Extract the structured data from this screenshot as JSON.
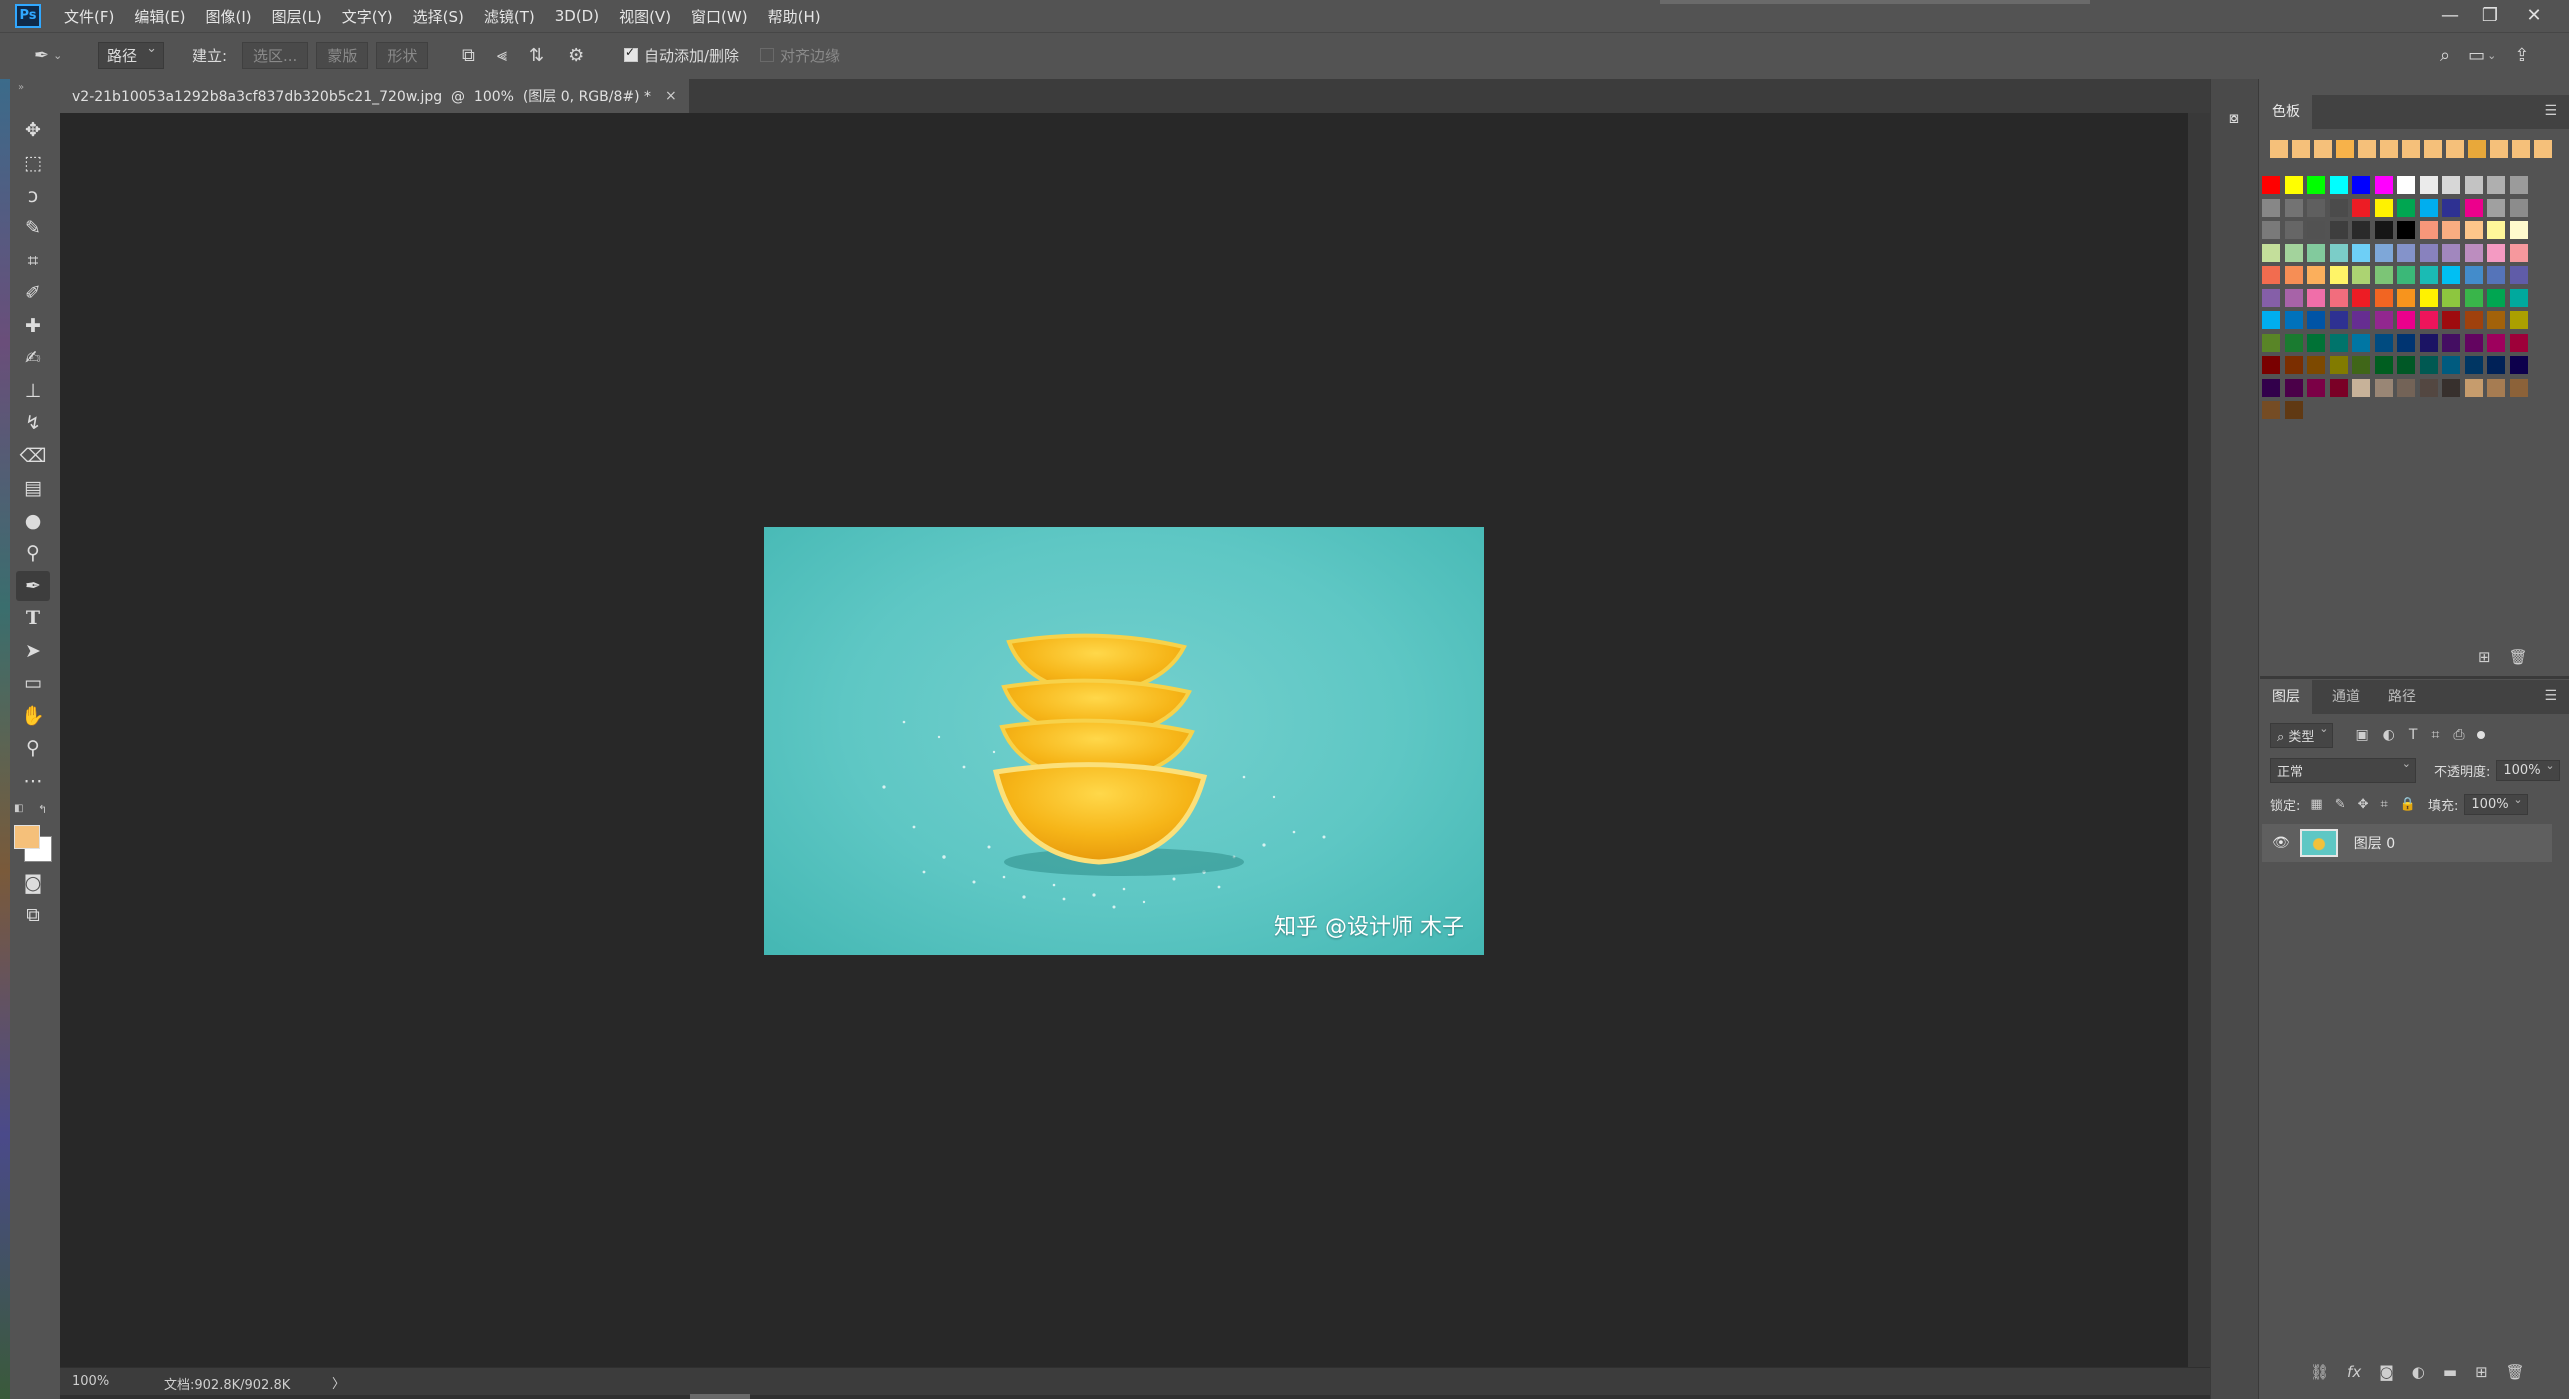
{
  "app": {
    "logo": "Ps",
    "menus": [
      "文件(F)",
      "编辑(E)",
      "图像(I)",
      "图层(L)",
      "文字(Y)",
      "选择(S)",
      "滤镜(T)",
      "3D(D)",
      "视图(V)",
      "窗口(W)",
      "帮助(H)"
    ],
    "window_controls": {
      "minimize": "—",
      "restore": "❐",
      "close": "✕"
    }
  },
  "options": {
    "tool_icon": "pen-icon",
    "mode": "路径",
    "make_label": "建立:",
    "selection_btn": "选区...",
    "mask_btn": "蒙版",
    "shape_btn": "形状",
    "auto_add_delete": "自动添加/删除",
    "align_edges": "对齐边缘"
  },
  "document": {
    "tab_title": "v2-21b10053a1292b8a3cf837db320b5c21_720w.jpg  @  100%  (图层 0, RGB/8#) *",
    "close": "×",
    "image_watermark": "知乎 @设计师 木子",
    "zoom": "100%",
    "doc_size": "文档:902.8K/902.8K",
    "status_arrow": "〉"
  },
  "swatches": {
    "tab": "色板",
    "recent_colors": [
      "#f5c07a",
      "#f5c07a",
      "#f5c07a",
      "#f7b24a",
      "#f5c07a",
      "#f5c07a",
      "#f5c07a",
      "#f5c07a",
      "#f5c07a",
      "#e8a83a",
      "#f5c07a",
      "#f5c07a",
      "#f5c07a"
    ],
    "grid_colors": [
      "#ff0000",
      "#ffff00",
      "#00ff00",
      "#00ffff",
      "#0000ff",
      "#ff00ff",
      "#ffffff",
      "#ebebeb",
      "#d7d7d7",
      "#c3c3c3",
      "#afafaf",
      "#9b9b9b",
      "#878787",
      "#737373",
      "#5f5f5f",
      "#4b4b4b",
      "#ed1c24",
      "#fff200",
      "#00a651",
      "#00aeef",
      "#2e3192",
      "#ec008c",
      "#a0a0a0",
      "#8c8c8c",
      "#7a7a7a",
      "#666666",
      "#525252",
      "#3e3e3e",
      "#2a2a2a",
      "#161616",
      "#000000",
      "#f7977a",
      "#f9ad81",
      "#fdc68a",
      "#fff79a",
      "#fffacd",
      "#c4df9b",
      "#a3d39c",
      "#82ca9d",
      "#7bcdc8",
      "#6ecff6",
      "#7ea7d8",
      "#8493ca",
      "#8882be",
      "#a187be",
      "#bc8dbf",
      "#f49ac2",
      "#f6989d",
      "#f26c4f",
      "#f68e55",
      "#fbaf5c",
      "#fff467",
      "#acd372",
      "#7cc576",
      "#3bb878",
      "#1abbb4",
      "#00bff3",
      "#438ccb",
      "#5574b9",
      "#605ca8",
      "#855fa8",
      "#a763a8",
      "#f06ea9",
      "#f26d7d",
      "#ed1c24",
      "#f26522",
      "#f7941d",
      "#fff200",
      "#8dc63f",
      "#39b54a",
      "#00a651",
      "#00a99d",
      "#00aeef",
      "#0072bc",
      "#0054a6",
      "#2e3192",
      "#662d91",
      "#92278f",
      "#ec008c",
      "#ed145b",
      "#9e0b0f",
      "#a0410d",
      "#a3620a",
      "#aba000",
      "#598527",
      "#1a7b30",
      "#007236",
      "#00746b",
      "#0076a3",
      "#004b80",
      "#003471",
      "#1b1464",
      "#440e62",
      "#630460",
      "#9e005d",
      "#9e0039",
      "#790000",
      "#7b2e00",
      "#7d4900",
      "#827b00",
      "#406618",
      "#005e20",
      "#005826",
      "#005952",
      "#005b7f",
      "#003663",
      "#002157",
      "#0d004c",
      "#32004b",
      "#4b0049",
      "#7b0046",
      "#7a0026",
      "#c7b299",
      "#998675",
      "#736357",
      "#534741",
      "#37302d",
      "#c69c6d",
      "#a67c52",
      "#8c6239",
      "#754c24",
      "#603913"
    ],
    "footer_icons": [
      "new-swatch-icon",
      "trash-icon"
    ]
  },
  "layers": {
    "tabs": [
      "图层",
      "通道",
      "路径"
    ],
    "filter_label": "类型",
    "blend_mode": "正常",
    "opacity_label": "不透明度:",
    "opacity_value": "100%",
    "lock_label": "锁定:",
    "fill_label": "填充:",
    "fill_value": "100%",
    "items": [
      {
        "name": "图层 0",
        "visible": true
      }
    ],
    "footer_icons": [
      "link-icon",
      "fx-icon",
      "mask-icon",
      "adjustment-icon",
      "group-icon",
      "new-layer-icon",
      "trash-icon"
    ],
    "footer_fx": "fx"
  },
  "colors": {
    "foreground": "#f5c07a",
    "background": "#ffffff"
  }
}
